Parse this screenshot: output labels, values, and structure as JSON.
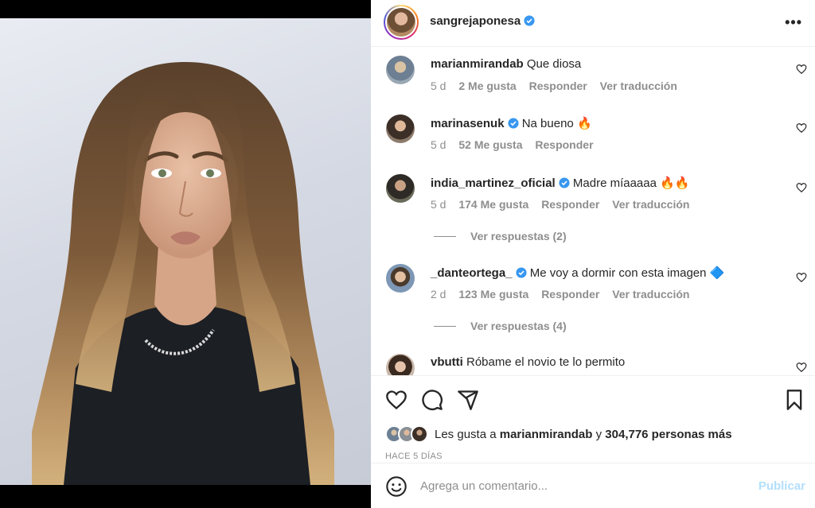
{
  "post": {
    "username": "sangrejaponesa",
    "verified": true,
    "more_label": "•••"
  },
  "comments": [
    {
      "user": "marianmirandab",
      "verified": false,
      "text": "Que diosa",
      "age": "5 d",
      "likes": "2 Me gusta",
      "reply": "Responder",
      "translate": "Ver traducción"
    },
    {
      "user": "marinasenuk",
      "verified": true,
      "text": "Na bueno 🔥",
      "age": "5 d",
      "likes": "52 Me gusta",
      "reply": "Responder",
      "translate": ""
    },
    {
      "user": "india_martinez_oficial",
      "verified": true,
      "text": "Madre míaaaaa 🔥🔥",
      "age": "5 d",
      "likes": "174 Me gusta",
      "reply": "Responder",
      "translate": "Ver traducción",
      "replies": "Ver respuestas (2)"
    },
    {
      "user": "_danteortega_",
      "verified": true,
      "text": "Me voy a dormir con esta imagen 🔷",
      "age": "2 d",
      "likes": "123 Me gusta",
      "reply": "Responder",
      "translate": "Ver traducción",
      "replies": "Ver respuestas (4)"
    },
    {
      "user": "vbutti",
      "verified": false,
      "text": "Róbame el novio te lo permito"
    }
  ],
  "likes": {
    "prefix": "Les gusta a",
    "user": "marianmirandab",
    "conjunction": "y",
    "count": "304,776 personas más"
  },
  "timestamp": "HACE 5 DÍAS",
  "composer": {
    "placeholder": "Agrega un comentario...",
    "publish_label": "Publicar"
  },
  "colors": {
    "verified_blue": "#3897f0",
    "publish_disabled": "#b2dffc",
    "muted_text": "#8e8e8e"
  }
}
